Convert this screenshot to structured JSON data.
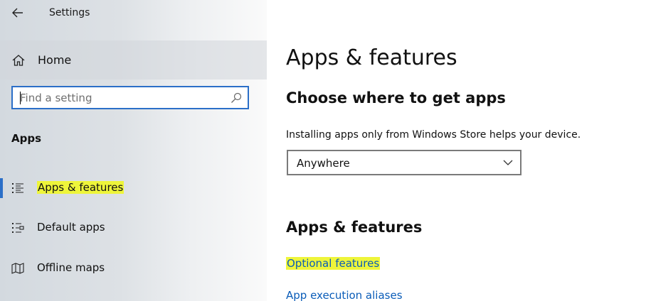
{
  "window": {
    "title": "Settings"
  },
  "sidebar": {
    "home_label": "Home",
    "search": {
      "placeholder": "Find a setting"
    },
    "section_label": "Apps",
    "items": [
      {
        "label": "Apps & features",
        "icon": "list-icon",
        "selected": true,
        "highlighted": true
      },
      {
        "label": "Default apps",
        "icon": "default-apps-icon",
        "selected": false
      },
      {
        "label": "Offline maps",
        "icon": "map-icon",
        "selected": false
      }
    ]
  },
  "main": {
    "title": "Apps & features",
    "choose_heading": "Choose where to get apps",
    "description": "Installing apps only from Windows Store helps your device.",
    "dropdown": {
      "selected": "Anywhere"
    },
    "features_heading": "Apps & features",
    "links": {
      "optional_features": "Optional features",
      "app_execution_aliases": "App execution aliases"
    }
  },
  "colors": {
    "accent": "#2b6fc8",
    "link": "#0a5cb8",
    "highlight": "#eef53a"
  }
}
